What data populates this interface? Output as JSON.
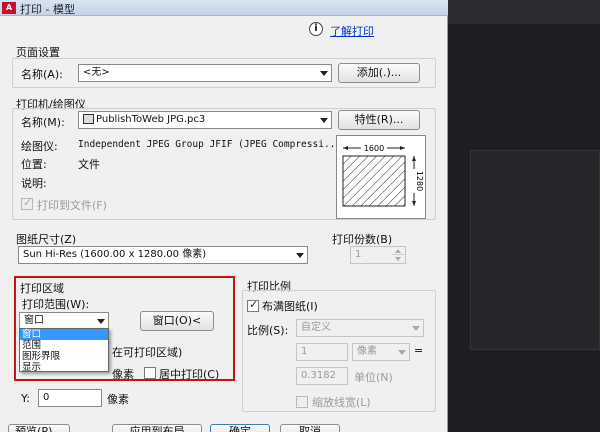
{
  "window": {
    "title": "打印 - 模型",
    "app_icon": "A"
  },
  "help": {
    "info_icon": "i",
    "link": "了解打印"
  },
  "page_setup": {
    "section": "页面设置",
    "name_label": "名称(A):",
    "name_value": "<无>",
    "add_button": "添加(.)..."
  },
  "printer": {
    "section": "打印机/绘图仪",
    "name_label": "名称(M):",
    "name_value": "PublishToWeb JPG.pc3",
    "properties_button": "特性(R)...",
    "plotter_label": "绘图仪:",
    "plotter_value": "Independent JPEG Group JFIF (JPEG Compressi...",
    "location_label": "位置:",
    "location_value": "文件",
    "description_label": "说明:",
    "print_to_file": "打印到文件(F)",
    "preview_width": "1600",
    "preview_height": "1280"
  },
  "paper": {
    "section": "图纸尺寸(Z)",
    "value": "Sun Hi-Res (1600.00 x 1280.00 像素)"
  },
  "copies": {
    "section": "打印份数(B)",
    "value": "1"
  },
  "plot_area": {
    "section": "打印区域",
    "range_label": "打印范围(W):",
    "range_value": "窗口",
    "window_button": "窗口(O)<",
    "options": [
      "窗口",
      "范围",
      "图形界限",
      "显示"
    ],
    "selected_option": "窗口"
  },
  "plot_offset": {
    "section_partial": "在可打印区域)",
    "x_unit": "像素",
    "center_label": "居中打印(C)",
    "y_label": "Y:",
    "y_value": "0",
    "y_unit": "像素"
  },
  "scale": {
    "section": "打印比例",
    "fit_label": "布满图纸(I)",
    "scale_label": "比例(S):",
    "scale_value": "自定义",
    "value1": "1",
    "unit_value": "像素",
    "equals": "=",
    "value2": "0.3182",
    "unit_label": "单位(N)",
    "lineweights_label": "缩放线宽(L)"
  },
  "bottom_buttons": {
    "apply": "应用到布局",
    "ok": "确定",
    "cancel": "取消",
    "preview": "预览(P)..."
  },
  "colors": {
    "highlight_red": "#c8101a",
    "link_blue": "#0033cc",
    "select_blue": "#3399ff"
  }
}
